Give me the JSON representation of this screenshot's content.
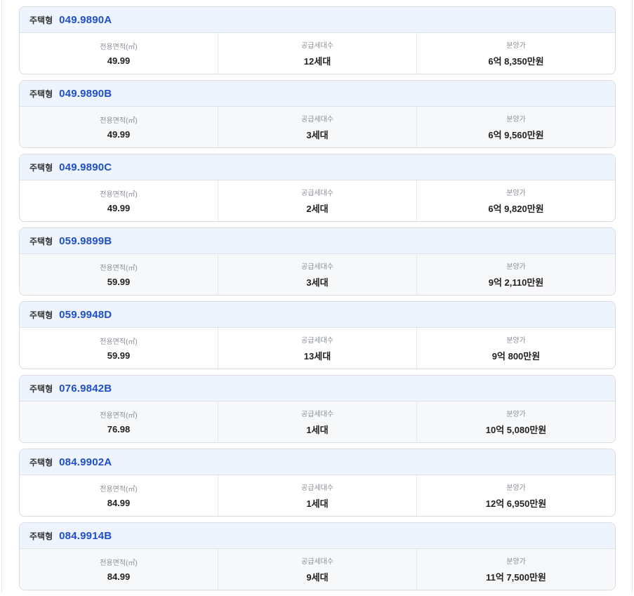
{
  "labels": {
    "housing_type": "주택형",
    "area": "전용면적(㎡)",
    "supply": "공급세대수",
    "price": "분양가"
  },
  "units": [
    {
      "type": "049.9890A",
      "area": "49.99",
      "supply": "12세대",
      "price": "6억 8,350만원"
    },
    {
      "type": "049.9890B",
      "area": "49.99",
      "supply": "3세대",
      "price": "6억 9,560만원"
    },
    {
      "type": "049.9890C",
      "area": "49.99",
      "supply": "2세대",
      "price": "6억 9,820만원"
    },
    {
      "type": "059.9899B",
      "area": "59.99",
      "supply": "3세대",
      "price": "9억 2,110만원"
    },
    {
      "type": "059.9948D",
      "area": "59.99",
      "supply": "13세대",
      "price": "9억 800만원"
    },
    {
      "type": "076.9842B",
      "area": "76.98",
      "supply": "1세대",
      "price": "10억 5,080만원"
    },
    {
      "type": "084.9902A",
      "area": "84.99",
      "supply": "1세대",
      "price": "12억 6,950만원"
    },
    {
      "type": "084.9914B",
      "area": "84.99",
      "supply": "9세대",
      "price": "11억 7,500만원"
    }
  ],
  "colors": {
    "accent": "#1f4fc8",
    "header_bg": "#eef4fe",
    "border": "#d9dde3"
  }
}
